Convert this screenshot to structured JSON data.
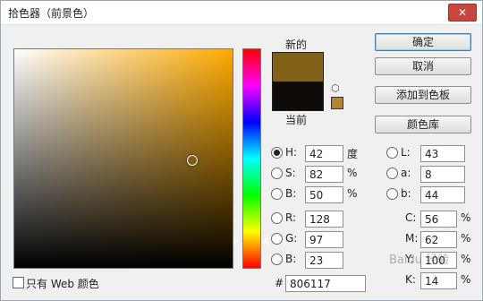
{
  "window": {
    "title": "拾色器（前景色）",
    "close_glyph": "✕"
  },
  "swatches": {
    "new_label": "新的",
    "current_label": "当前",
    "new_color": "#806117",
    "current_color": "#0e0b08"
  },
  "buttons": {
    "ok": "确定",
    "cancel": "取消",
    "add_to_swatches": "添加到色板",
    "color_libraries": "颜色库"
  },
  "hsb": {
    "h": {
      "label": "H:",
      "value": "42",
      "unit": "度",
      "selected": true
    },
    "s": {
      "label": "S:",
      "value": "82",
      "unit": "%"
    },
    "b": {
      "label": "B:",
      "value": "50",
      "unit": "%"
    }
  },
  "rgb": {
    "r": {
      "label": "R:",
      "value": "128"
    },
    "g": {
      "label": "G:",
      "value": "97"
    },
    "b": {
      "label": "B:",
      "value": "23"
    }
  },
  "lab": {
    "l": {
      "label": "L:",
      "value": "43"
    },
    "a": {
      "label": "a:",
      "value": "8"
    },
    "b": {
      "label": "b:",
      "value": "44"
    }
  },
  "cmyk": {
    "c": {
      "label": "C:",
      "value": "56",
      "unit": "%"
    },
    "m": {
      "label": "M:",
      "value": "62",
      "unit": "%"
    },
    "y": {
      "label": "Y:",
      "value": "100",
      "unit": "%"
    },
    "k": {
      "label": "K:",
      "value": "14",
      "unit": "%"
    }
  },
  "hex": {
    "label": "#",
    "value": "806117"
  },
  "web_only": {
    "label": "只有 Web 颜色",
    "checked": false
  },
  "watermark": "Baidu 经验",
  "icons": {
    "gamut_warning": "cube-icon",
    "web_safe": "web-safe-swatch"
  }
}
